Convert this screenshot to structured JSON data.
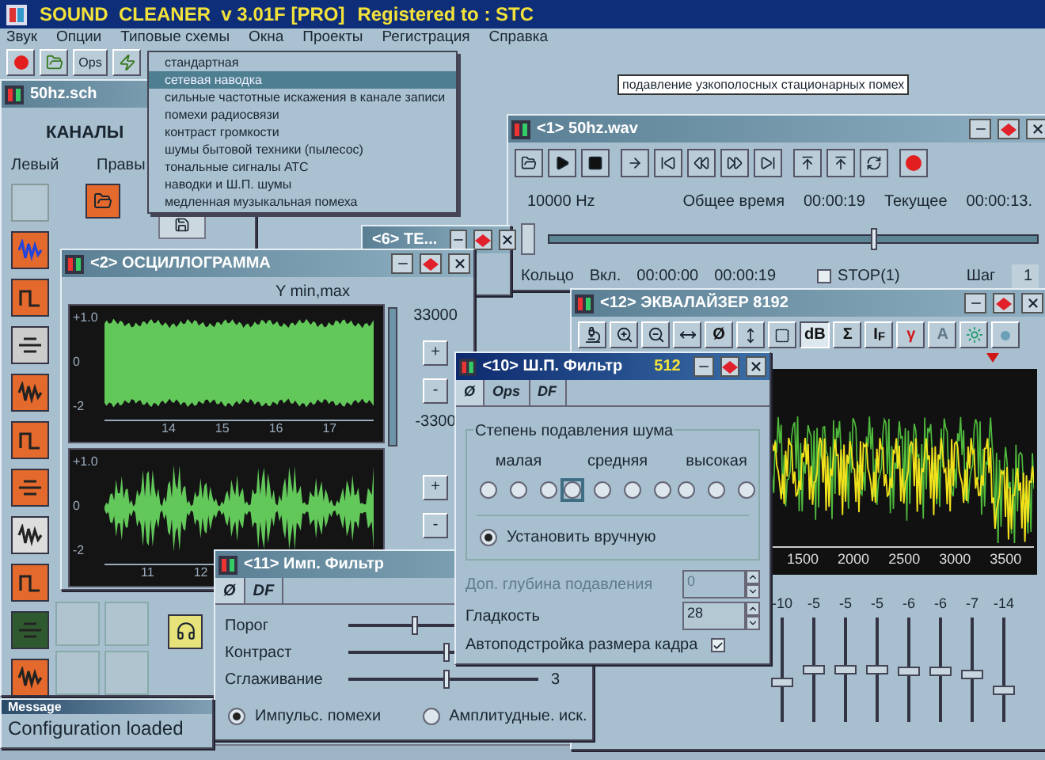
{
  "app": {
    "title": "SOUND  CLEANER  v 3.01F [PRO]",
    "registration": "Registered to : STC"
  },
  "menu": [
    {
      "label": "Звук"
    },
    {
      "label": "Опции"
    },
    {
      "label": "Типовые схемы"
    },
    {
      "label": "Окна"
    },
    {
      "label": "Проекты"
    },
    {
      "label": "Регистрация"
    },
    {
      "label": "Справка"
    }
  ],
  "toolbar": {
    "label": "Ops"
  },
  "preset_menu": [
    {
      "label": "стандартная",
      "selected": false
    },
    {
      "label": "сетевая наводка",
      "selected": true
    },
    {
      "label": "сильные частотные искажения в канале записи",
      "selected": false
    },
    {
      "label": "помехи радиосвязи",
      "selected": false
    },
    {
      "label": "контраст громкости",
      "selected": false
    },
    {
      "label": "шумы бытовой техники (пылесос)",
      "selected": false
    },
    {
      "label": "тональные сигналы АТС",
      "selected": false
    },
    {
      "label": "наводки и Ш.П. шумы",
      "selected": false
    },
    {
      "label": "медленная музыкальная помеха",
      "selected": false
    }
  ],
  "tooltip": "подавление узкополосных стационарных помех",
  "channels_window": {
    "title": "50hz.sch",
    "heading": "КАНАЛЫ",
    "left_label": "Левый",
    "right_label": "Правы"
  },
  "window_6": {
    "title": "<6> TE..."
  },
  "player": {
    "title": "<1>  50hz.wav",
    "frequency": "10000 Hz",
    "total_label": "Общее время",
    "total": "00:00:19",
    "current_label": "Текущее",
    "current": "00:00:13.",
    "position": {
      "level": 0.66
    },
    "loop_label": "Кольцо",
    "loop_state": "Вкл.",
    "loop_start": "00:00:00",
    "loop_end": "00:00:19",
    "stop": {
      "label": "STOP(1)",
      "checked": false
    },
    "step_label": "Шаг",
    "step": "1"
  },
  "oscillogram": {
    "title": "<2> ОСЦИЛЛОГРАММА",
    "scale_label": "Y min,max",
    "scale_max": "33000",
    "scale_min": "-3300",
    "zoom_buttons": [
      "+",
      "-",
      "+",
      "-"
    ],
    "plots": [
      {
        "y_labels": [
          "+1.0",
          "0",
          "-2"
        ],
        "x_labels": [
          "14",
          "15",
          "16",
          "17"
        ]
      },
      {
        "y_labels": [
          "+1.0",
          "0",
          "-2"
        ],
        "x_labels": [
          "11",
          "12"
        ]
      }
    ]
  },
  "equalizer": {
    "title": "<12> ЭКВАЛАЙЗЕР  8192",
    "text_tools": [
      {
        "label": "Ø",
        "selected": false,
        "disabled": false
      },
      {
        "label": "dB",
        "selected": true,
        "disabled": false
      },
      {
        "label": "Σ",
        "selected": false,
        "disabled": false
      },
      {
        "label": "I$_{F}$",
        "selected": false,
        "disabled": false
      },
      {
        "label": "γ",
        "selected": false,
        "disabled": false
      },
      {
        "label": "A",
        "selected": false,
        "disabled": true
      }
    ],
    "x_labels": [
      "1500",
      "2000",
      "2500",
      "3000",
      "3500"
    ],
    "bands": [
      {
        "reading": "-10",
        "level": 0.38
      },
      {
        "reading": "-5",
        "level": 0.5
      },
      {
        "reading": "-5",
        "level": 0.5
      },
      {
        "reading": "-5",
        "level": 0.5
      },
      {
        "reading": "-6",
        "level": 0.48
      },
      {
        "reading": "-6",
        "level": 0.48
      },
      {
        "reading": "-7",
        "level": 0.45
      },
      {
        "reading": "-14",
        "level": 0.3
      }
    ]
  },
  "noise_filter": {
    "title": "<10> Ш.П. Фильтр",
    "size": "512",
    "tabs": [
      {
        "label": "Ø",
        "selected": true
      },
      {
        "label": "Ops",
        "selected": false
      },
      {
        "label": "DF",
        "selected": false
      }
    ],
    "group_label": "Степень подавления шума",
    "levels": [
      {
        "label": "малая",
        "options": [
          {
            "selected": false,
            "focused": false
          },
          {
            "selected": false,
            "focused": false
          },
          {
            "selected": false,
            "focused": false
          }
        ]
      },
      {
        "label": "средняя",
        "options": [
          {
            "selected": false,
            "focused": true
          },
          {
            "selected": false,
            "focused": false
          },
          {
            "selected": false,
            "focused": false
          },
          {
            "selected": false,
            "focused": false
          }
        ]
      },
      {
        "label": "высокая",
        "options": [
          {
            "selected": false,
            "focused": false
          },
          {
            "selected": false,
            "focused": false
          },
          {
            "selected": false,
            "focused": false
          }
        ]
      }
    ],
    "manual": {
      "label": "Установить вручную",
      "selected": true
    },
    "fields": [
      {
        "label": "Доп. глубина подавления",
        "value": "0",
        "disabled": true
      },
      {
        "label": "Гладкость",
        "value": "28",
        "disabled": false
      }
    ],
    "auto_frame": {
      "label": "Автоподстройка размера кадра",
      "checked": true
    }
  },
  "imp_filter": {
    "title": "<11> Имп. Фильтр",
    "tabs": [
      {
        "label": "Ø",
        "selected": true
      },
      {
        "label": "DF",
        "selected": false
      }
    ],
    "sliders": [
      {
        "label": "Порог",
        "level": 0.35
      },
      {
        "label": "Контраст",
        "level": 0.52
      },
      {
        "label": "Сглаживание",
        "level": 0.52,
        "reading": "3"
      }
    ],
    "modes": [
      {
        "label": "Импульс. помехи",
        "selected": true
      },
      {
        "label": "Амплитудные. иск.",
        "selected": false
      }
    ]
  },
  "message": {
    "title": "Message",
    "text": "Configuration loaded"
  }
}
